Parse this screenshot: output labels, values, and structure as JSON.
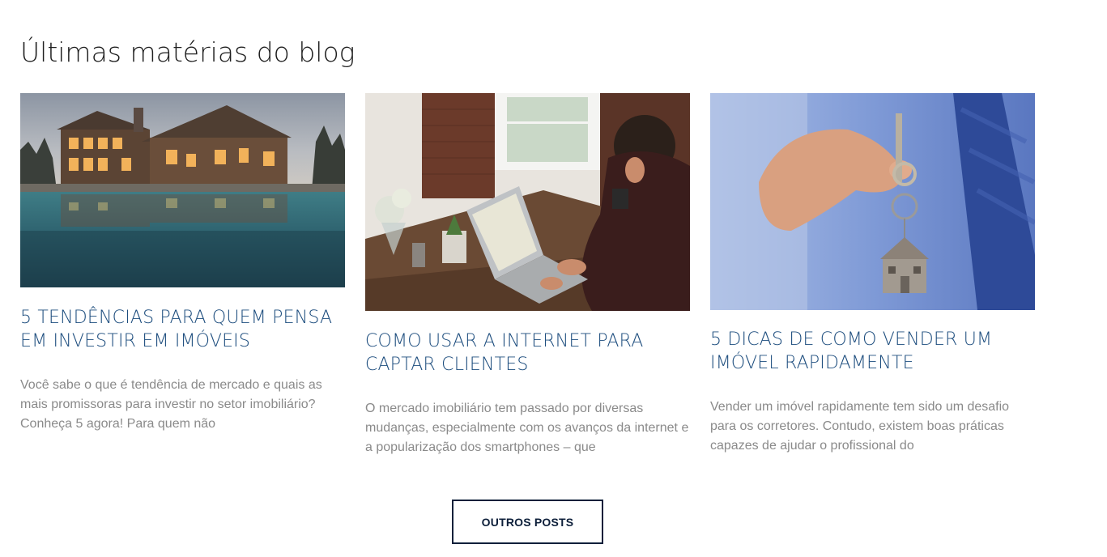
{
  "section": {
    "title": "Últimas matérias do blog"
  },
  "posts": [
    {
      "title": "5 TENDÊNCIAS PARA QUEM PENSA EM INVESTIR EM IMÓVEIS",
      "excerpt": "Você sabe o que é tendência de mercado e quais as mais promissoras para investir no setor imobiliário? Conheça 5 agora! Para quem não",
      "image": "house-with-pool-at-dusk"
    },
    {
      "title": "COMO USAR A INTERNET PARA CAPTAR CLIENTES",
      "excerpt": "O mercado imobiliário tem passado por diversas mudanças, especialmente com os avanços da internet e a popularização dos smartphones – que",
      "image": "man-working-on-laptop"
    },
    {
      "title": "5 DICAS DE COMO VENDER UM IMÓVEL RAPIDAMENTE",
      "excerpt": "Vender um imóvel rapidamente tem sido um desafio para os corretores. Contudo, existem boas práticas capazes de ajudar o profissional do",
      "image": "hand-holding-house-keys"
    }
  ],
  "cta": {
    "label": "OUTROS POSTS"
  },
  "colors": {
    "title": "#1e1e1e",
    "post_title": "#1d4d7e",
    "excerpt": "#8a8a8a",
    "button_border": "#0d1f3a"
  }
}
